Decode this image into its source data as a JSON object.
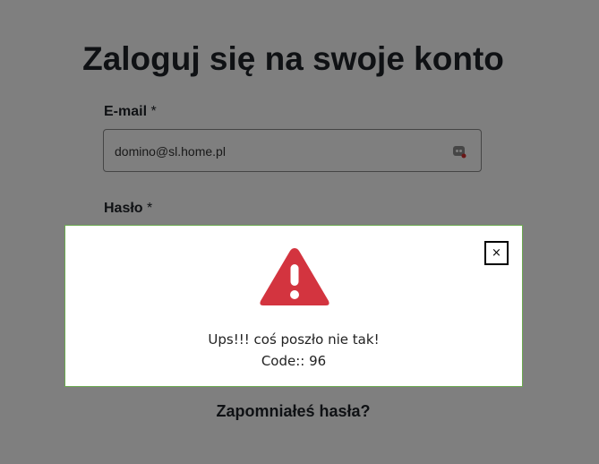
{
  "page": {
    "title": "Zaloguj się na swoje konto"
  },
  "form": {
    "email_label": "E-mail",
    "password_label": "Hasło",
    "required_marker": "*",
    "email_value": "domino@sl.home.pl",
    "forgot_password_label": "Zapomniałeś hasła?"
  },
  "modal": {
    "icon": "warning-triangle-icon",
    "message": "Ups!!! coś poszło nie tak!",
    "code_text": "Code:: 96",
    "close_label": "×",
    "icon_color": "#d3343f",
    "border_color": "#6aa84f"
  }
}
